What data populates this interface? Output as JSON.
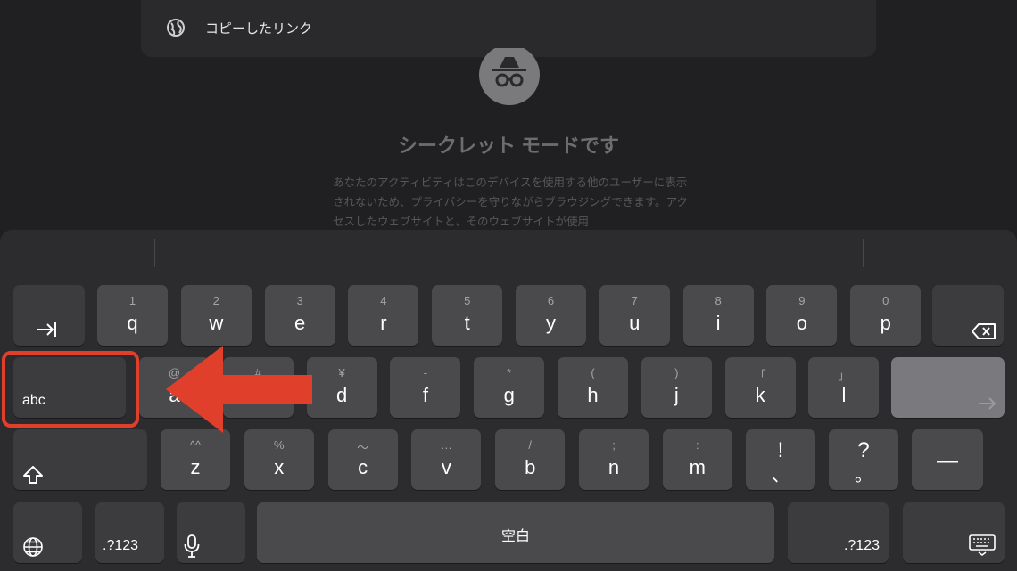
{
  "suggestion": {
    "icon": "globe-icon",
    "label": "コピーしたリンク"
  },
  "incognito": {
    "title": "シークレット モードです",
    "description": "あなたのアクティビティはこのデバイスを使用する他のユーザーに表示されないため、プライバシーを守りながらブラウジングできます。アクセスしたウェブサイトと、そのウェブサイトが使用"
  },
  "keyboard": {
    "row1": [
      {
        "key": "q",
        "sub": "1"
      },
      {
        "key": "w",
        "sub": "2"
      },
      {
        "key": "e",
        "sub": "3"
      },
      {
        "key": "r",
        "sub": "4"
      },
      {
        "key": "t",
        "sub": "5"
      },
      {
        "key": "y",
        "sub": "6"
      },
      {
        "key": "u",
        "sub": "7"
      },
      {
        "key": "i",
        "sub": "8"
      },
      {
        "key": "o",
        "sub": "9"
      },
      {
        "key": "p",
        "sub": "0"
      }
    ],
    "row2": [
      {
        "key": "a",
        "sub": "@"
      },
      {
        "key": "s",
        "sub": "#"
      },
      {
        "key": "d",
        "sub": "¥"
      },
      {
        "key": "f",
        "sub": "-"
      },
      {
        "key": "g",
        "sub": "*"
      },
      {
        "key": "h",
        "sub": "("
      },
      {
        "key": "j",
        "sub": ")"
      },
      {
        "key": "k",
        "sub": "「"
      },
      {
        "key": "l",
        "sub": "」"
      }
    ],
    "row3": [
      {
        "key": "z",
        "sub": "^^"
      },
      {
        "key": "x",
        "sub": "%"
      },
      {
        "key": "c",
        "sub": "〜"
      },
      {
        "key": "v",
        "sub": "…"
      },
      {
        "key": "b",
        "sub": "/"
      },
      {
        "key": "n",
        "sub": ";"
      },
      {
        "key": "m",
        "sub": ":"
      }
    ],
    "abc_label": "abc",
    "exclaim": {
      "key": "!",
      "sub": "、"
    },
    "question": {
      "key": "?",
      "sub": "。"
    },
    "dash": "—",
    "numbers_left": ".?123",
    "numbers_right": ".?123",
    "space": "空白",
    "icons": [
      "tab-icon",
      "delete-icon",
      "return-icon",
      "shift-icon",
      "globe-icon",
      "microphone-icon",
      "keyboard-hide-icon"
    ]
  },
  "colors": {
    "highlight": "#e0402b",
    "key": "#4a4a4d",
    "keyboard_bg": "#2c2c2e"
  }
}
